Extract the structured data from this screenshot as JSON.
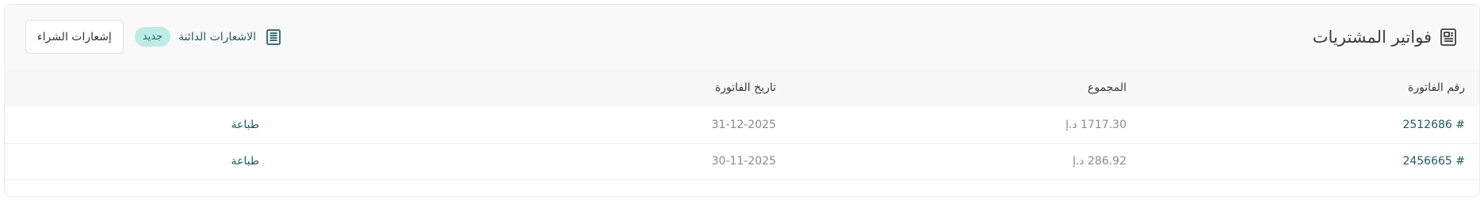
{
  "header": {
    "title": "فواتير المشتريات",
    "title_icon": "receipt-icon",
    "credit_notes_label": "الاشعارات الدائنة",
    "credit_notes_icon": "document-list-icon",
    "new_badge": "جديد",
    "purchase_notes_button": "إشعارات الشراء"
  },
  "table": {
    "columns": [
      "رقم الفاتورة",
      "المجموع",
      "تاريخ الفاتورة",
      ""
    ],
    "rows": [
      {
        "number": "# 2512686",
        "total": "1717.30 د.إ",
        "date": "31-12-2025",
        "action": "طباعة"
      },
      {
        "number": "# 2456665",
        "total": "286.92 د.إ",
        "date": "30-11-2025",
        "action": "طباعة"
      }
    ]
  },
  "colors": {
    "accent": "#1e5b66",
    "badge_bg": "#bdece6",
    "muted_text": "#8a8a8a"
  }
}
